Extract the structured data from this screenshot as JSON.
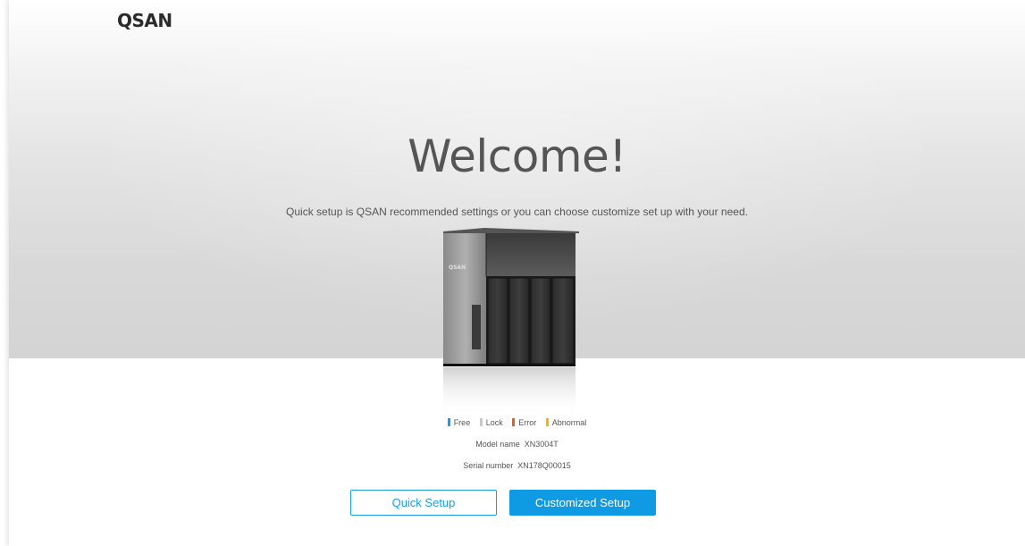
{
  "brand": {
    "logo_text": "QSAN"
  },
  "hero": {
    "title": "Welcome!",
    "subtitle": "Quick setup is QSAN recommended settings or you can choose customize set up with your need."
  },
  "device": {
    "badge_text": "QSAN",
    "drive_bays": 4
  },
  "legend": [
    {
      "label": "Free",
      "color": "#1a9ee0"
    },
    {
      "label": "Lock",
      "color": "#c8c8c8"
    },
    {
      "label": "Error",
      "color": "#f05a28"
    },
    {
      "label": "Abnormal",
      "color": "#f5b800"
    }
  ],
  "info": {
    "model_label": "Model name",
    "model_value": "XN3004T",
    "serial_label": "Serial number",
    "serial_value": "XN178Q00015"
  },
  "buttons": {
    "quick_setup": "Quick Setup",
    "customized_setup": "Customized Setup"
  },
  "colors": {
    "accent": "#0e9be4",
    "text": "#555555"
  }
}
